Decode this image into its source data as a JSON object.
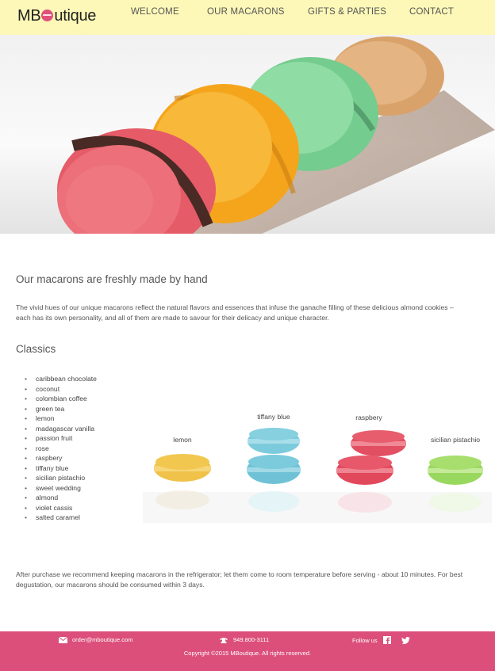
{
  "header": {
    "logo": {
      "prefix": "MB",
      "suffix": "utique"
    },
    "nav": [
      "WELCOME",
      "OUR MACARONS",
      "GIFTS & PARTIES",
      "CONTACT"
    ]
  },
  "main": {
    "heading": "Our macarons are freshly made by hand",
    "intro_line1": "The vivid hues of our unique macarons reflect the natural flavors and essences that infuse the ganache filling of these delicious almond cookies –",
    "intro_line2": "each has its own personality, and all of them are made to savour for their delicacy and unique character.",
    "classics_heading": "Classics",
    "flavors": [
      "caribbean chocolate",
      "coconut",
      "colombian coffee",
      "green tea",
      "lemon",
      "madagascar vanilla",
      "passion fruit",
      "rose",
      "raspbery",
      "tiffany blue",
      "sicilian pistachio",
      "sweet wedding",
      "almond",
      "violet cassis",
      "salted caramel"
    ],
    "macaron_labels": {
      "lemon": "lemon",
      "tiffany": "tiffany blue",
      "raspbery": "raspbery",
      "pistachio": "sicilian pistachio"
    },
    "storage_line1": "After purchase we recommend keeping macarons in the refrigerator; let them come to room temperature before serving - about 10 minutes. For best",
    "storage_line2": "degustation, our macarons should be consumed within 3 days."
  },
  "footer": {
    "email": "order@mboutique.com",
    "phone": "949.800-3111",
    "follow": "Follow us",
    "copyright": "Copyright ©2015 MBoutique. All rights reserved.",
    "icons": [
      "envelope-icon",
      "phone-icon",
      "facebook-icon",
      "twitter-icon"
    ]
  },
  "colors": {
    "topbar": "#fdf8b8",
    "footer": "#db4f7a",
    "raspberry": "#e8506a",
    "lemon": "#f0c24a",
    "tiffany": "#7ccbdc",
    "pistachio": "#9fdc62",
    "orange": "#f6a81e",
    "green": "#7fd49a",
    "caramel": "#d9a26a"
  }
}
